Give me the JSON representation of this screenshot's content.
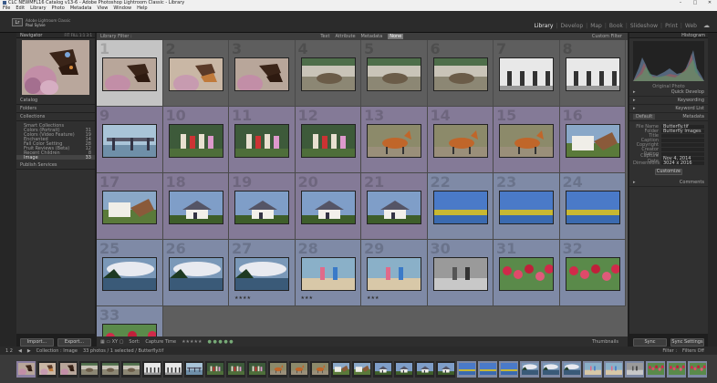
{
  "window": {
    "title": "CLC NEWMFL16 Catalog v13-6 - Adobe Photoshop Lightroom Classic - Library"
  },
  "window_controls": [
    "–",
    "□",
    "✕"
  ],
  "menu": [
    "File",
    "Edit",
    "Library",
    "Photo",
    "Metadata",
    "View",
    "Window",
    "Help"
  ],
  "identity": {
    "logo": "Lr",
    "line1": "Adobe Lightroom Classic",
    "line2": "Paul Sylvie"
  },
  "modules": [
    "Library",
    "Develop",
    "Map",
    "Book",
    "Slideshow",
    "Print",
    "Web"
  ],
  "left": {
    "navigator": "Navigator",
    "nav_zoom": "FIT  FILL  1:1  3:1",
    "catalog": "Catalog",
    "folders": "Folders",
    "collections": "Collections",
    "collection_items": [
      {
        "label": "Smart Collections",
        "count": ""
      },
      {
        "label": "Colors (Portrait)",
        "count": "31"
      },
      {
        "label": "Colors (Video Feature)",
        "count": "19"
      },
      {
        "label": "Enchanted",
        "count": "14"
      },
      {
        "label": "Fall Color Setting",
        "count": "28"
      },
      {
        "label": "Fruit Reviews (Beta)",
        "count": "12"
      },
      {
        "label": "Recent Children",
        "count": "8"
      },
      {
        "label": "Image",
        "count": "33"
      }
    ],
    "publish": "Publish Services",
    "import_btn": "Import...",
    "export_btn": "Export..."
  },
  "grid": {
    "header_left": "Library Filter :",
    "filters": [
      "Text",
      "Attribute",
      "Metadata",
      "None"
    ],
    "filters_active": "None",
    "filter_right": "Custom Filter",
    "numbers": [
      "1",
      "2",
      "3",
      "4",
      "5",
      "6",
      "7",
      "8",
      "9",
      "10",
      "11",
      "12",
      "13",
      "14",
      "15",
      "16",
      "17",
      "18",
      "19",
      "20",
      "21",
      "22",
      "23",
      "24",
      "25",
      "26",
      "27",
      "28",
      "29",
      "30",
      "31",
      "32",
      "33"
    ],
    "stars": [
      "",
      "",
      "",
      "",
      "",
      "",
      "",
      "",
      "",
      "",
      "",
      "",
      "",
      "",
      "",
      "",
      "",
      "",
      "",
      "",
      "",
      "",
      "",
      "",
      "",
      "",
      "★★★★",
      "★★★",
      "★★★",
      "",
      "",
      "",
      ""
    ]
  },
  "toolbar": {
    "icons": "▦ ▭ XY ▢",
    "sort_label": "Sort:",
    "sort_value": "Capture Time",
    "rating": "★★★★★",
    "flags": "● ● ● ● ●",
    "thumbs": "Thumbnails"
  },
  "right": {
    "histogram": "Histogram",
    "original": "Original Photo",
    "quick_develop": "Quick Develop",
    "keywording": "Keywording",
    "keyword_list": "Keyword List",
    "metadata": "Metadata",
    "metadata_preset": "Default",
    "meta": [
      {
        "k": "File Name",
        "v": "Butterfly.tif"
      },
      {
        "k": "Folder",
        "v": "Butterfly Images"
      },
      {
        "k": "Title",
        "v": ""
      },
      {
        "k": "Caption",
        "v": ""
      },
      {
        "k": "Copyright",
        "v": ""
      },
      {
        "k": "Creator",
        "v": ""
      },
      {
        "k": "Rating",
        "v": ""
      },
      {
        "k": "Capture Date",
        "v": "Nov 4, 2014"
      },
      {
        "k": "Dimensions",
        "v": "3024 x 2016"
      }
    ],
    "customize": "Customize",
    "comments": "Comments",
    "sync_btn": "Sync",
    "sync_settings": "Sync Settings"
  },
  "filmstrip": {
    "page": "1 2",
    "source": "Collection : Image",
    "count": "33 photos / 1 selected / Butterfly.tif",
    "filter_label": "Filter :",
    "filter_value": "Filters Off"
  },
  "colors": {
    "accent": "#cfcfcf",
    "select_purple": "#847a97",
    "select_blue": "#7f8aa6"
  }
}
